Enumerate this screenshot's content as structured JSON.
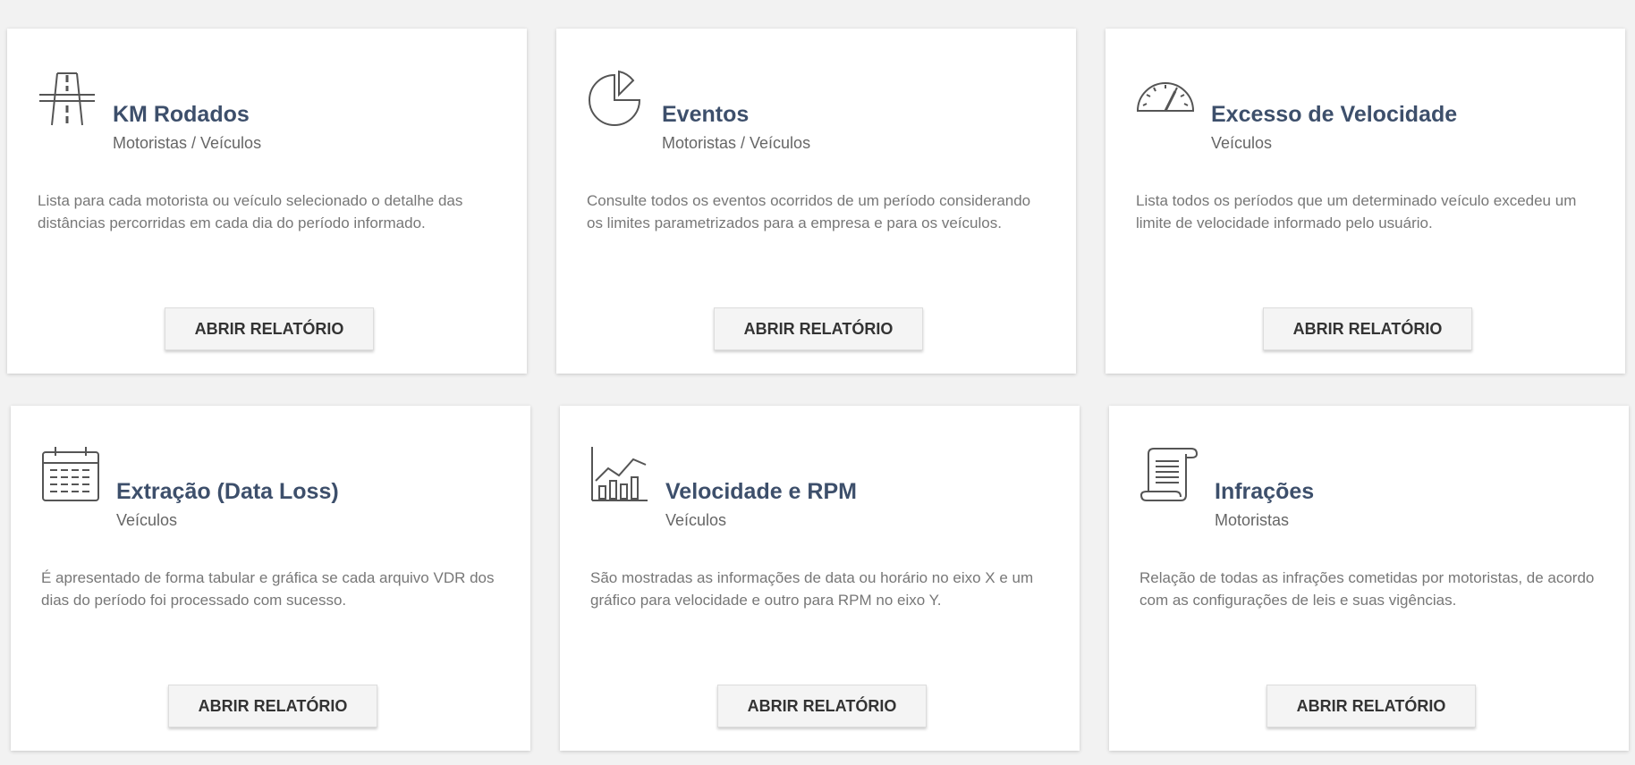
{
  "cards": [
    {
      "title": "KM Rodados",
      "subtitle": "Motoristas / Veículos",
      "description": "Lista para cada motorista ou veículo selecionado o detalhe das distâncias percorridas em cada dia do período informado.",
      "button_label": "ABRIR RELATÓRIO",
      "icon": "road-icon"
    },
    {
      "title": "Eventos",
      "subtitle": "Motoristas / Veículos",
      "description": "Consulte todos os eventos ocorridos de um período considerando os limites parametrizados para a empresa e para os veículos.",
      "button_label": "ABRIR RELATÓRIO",
      "icon": "pie-chart-icon"
    },
    {
      "title": "Excesso de Velocidade",
      "subtitle": "Veículos",
      "description": "Lista todos os períodos que um determinado veículo excedeu um limite de velocidade informado pelo usuário.",
      "button_label": "ABRIR RELATÓRIO",
      "icon": "speedometer-icon"
    },
    {
      "title": "Extração (Data Loss)",
      "subtitle": "Veículos",
      "description": "É apresentado de forma tabular e gráfica se cada arquivo VDR dos dias do período foi processado com sucesso.",
      "button_label": "ABRIR RELATÓRIO",
      "icon": "calendar-icon"
    },
    {
      "title": "Velocidade e RPM",
      "subtitle": "Veículos",
      "description": "São mostradas as informações de data ou horário no eixo X e um gráfico para velocidade e outro para RPM no eixo Y.",
      "button_label": "ABRIR RELATÓRIO",
      "icon": "bar-line-chart-icon"
    },
    {
      "title": "Infrações",
      "subtitle": "Motoristas",
      "description": "Relação de todas as infrações cometidas por motoristas, de acordo com as configurações de leis e suas vigências.",
      "button_label": "ABRIR RELATÓRIO",
      "icon": "scroll-document-icon"
    }
  ]
}
